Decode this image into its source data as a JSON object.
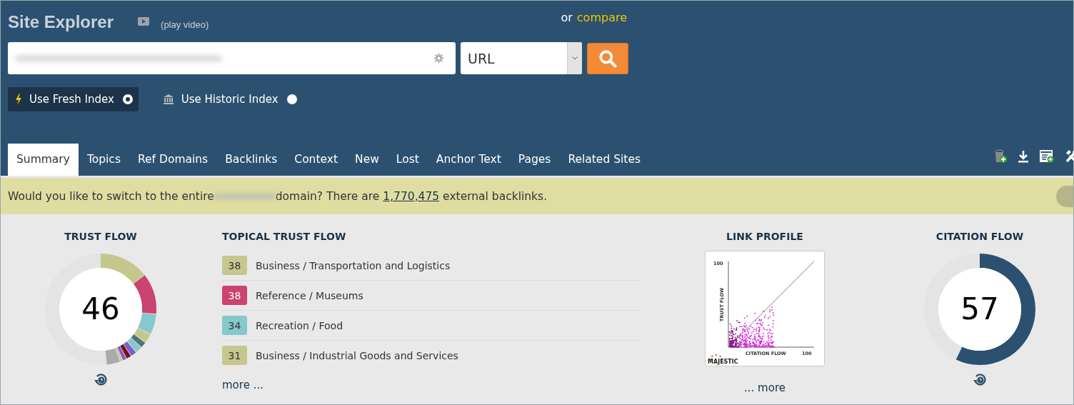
{
  "header": {
    "title": "Site Explorer",
    "video_link": "(play video)",
    "compare_prefix": "or",
    "compare_link": "compare"
  },
  "search": {
    "type_select": "URL"
  },
  "index_options": [
    {
      "label": "Use Fresh Index",
      "kind": "fresh",
      "selected": true
    },
    {
      "label": "Use Historic Index",
      "kind": "historic",
      "selected": false
    }
  ],
  "tabs": [
    {
      "label": "Summary",
      "selected": true
    },
    {
      "label": "Topics",
      "selected": false
    },
    {
      "label": "Ref Domains",
      "selected": false
    },
    {
      "label": "Backlinks",
      "selected": false
    },
    {
      "label": "Context",
      "selected": false
    },
    {
      "label": "New",
      "selected": false
    },
    {
      "label": "Lost",
      "selected": false
    },
    {
      "label": "Anchor Text",
      "selected": false
    },
    {
      "label": "Pages",
      "selected": false
    },
    {
      "label": "Related Sites",
      "selected": false
    }
  ],
  "toolbar": [
    {
      "kind": "bucket"
    },
    {
      "kind": "download"
    },
    {
      "kind": "report"
    },
    {
      "kind": "tools"
    }
  ],
  "banner": {
    "before": "Would you like to switch to the entire",
    "middle": "domain? There are",
    "link": "1,770,475",
    "after": "external backlinks."
  },
  "trust_flow": {
    "title": "TRUST FLOW",
    "value": "46"
  },
  "topical_trust_flow": {
    "title": "TOPICAL TRUST FLOW",
    "more": "more ...",
    "topics": [
      {
        "score": "38",
        "label": "Business / Transportation and Logistics",
        "color": "#c5c78e"
      },
      {
        "score": "38",
        "label": "Reference / Museums",
        "color": "#c9446e"
      },
      {
        "score": "34",
        "label": "Recreation / Food",
        "color": "#86c8cb"
      },
      {
        "score": "31",
        "label": "Business / Industrial Goods and Services",
        "color": "#c5c78e"
      }
    ]
  },
  "link_profile": {
    "title": "LINK PROFILE",
    "y_tick": "100",
    "y_label": "TRUST FLOW",
    "x_label": "CITATION FLOW",
    "x_tick": "100",
    "logo": "MAJESTIC",
    "more": "... more"
  },
  "citation_flow": {
    "title": "CITATION FLOW",
    "value": "57"
  }
}
